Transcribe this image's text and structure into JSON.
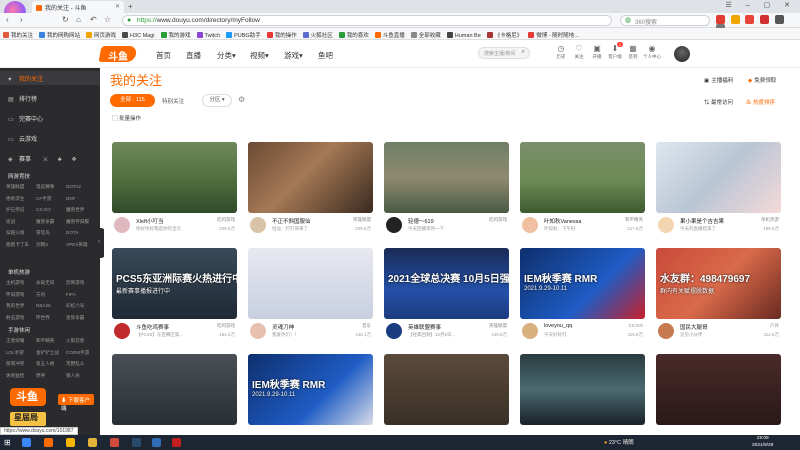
{
  "browser": {
    "tab_title": "我的关注 - 斗鱼",
    "url_protocol": "https://",
    "url_rest": "www.douyu.com/directory/myFollow",
    "search_placeholder": "360搜索",
    "bookmarks": [
      "我的关注",
      "我的网购网站",
      "网页游戏",
      "H3C Magi",
      "我的游戏",
      "Twitch",
      "PUBG助手",
      "我的操作",
      "火狐社区",
      "我的喜欢",
      "斗鱼直播",
      "全部收藏",
      "Human Be",
      "《卡格尼》",
      "微博 - 随时随地..."
    ]
  },
  "site": {
    "logo_text": "斗鱼",
    "nav": [
      "首页",
      "直播",
      "分类",
      "视频",
      "游戏",
      "鱼吧"
    ],
    "search_placeholder": "搜索主播/房间",
    "header_icons": [
      "历史",
      "关注",
      "开播",
      "客户端",
      "签到",
      "个人中心"
    ],
    "badge": "1"
  },
  "sidebar": {
    "items": [
      "我的关注",
      "排行榜",
      "完赛中心",
      "云游戏"
    ],
    "row3": [
      "赛事",
      "",
      "",
      ""
    ],
    "sections": [
      {
        "title": "网游竞技",
        "items": [
          "英雄联盟",
          "电竞赛事",
          "DOTA2",
          "绝地求生",
          "CF手游",
          "DNF",
          "炉石传说",
          "CS:GO",
          "魔兽世界",
          "逆战",
          "魔兽争霸",
          "魔兽怀旧服",
          "穿越火线",
          "冒险岛",
          "DOTA",
          "跑跑卡丁车",
          "剑网3",
          "APEX英雄"
        ]
      },
      {
        "title": "单机热游",
        "items": [
          "主机游戏",
          "永劫无间",
          "恐怖游戏",
          "怀旧游戏",
          "方舟",
          "FIFA",
          "我的世界",
          "NBA2K",
          "彩虹六号",
          "射击游戏",
          "环世界",
          "星际争霸"
        ]
      },
      {
        "title": "手游休闲",
        "items": [
          "王者荣耀",
          "和平精英",
          "火影忍者",
          "LOL手游",
          "金铲铲之战",
          "CODM手游",
          "部落冲突",
          "第五人格",
          "荒野乱斗",
          "休闲益智",
          "原神",
          "狼人杀"
        ]
      }
    ],
    "download_label": "下载客户端",
    "foot_logo": "斗鱼",
    "foot_sub": "星届局"
  },
  "main": {
    "title": "我的关注",
    "top_right": [
      "主播福利",
      "免费领取"
    ],
    "filters": {
      "all": "全部 · 115",
      "special": "特别关注",
      "zone": "分区"
    },
    "batch": "批量操作",
    "sort": [
      "最常访问",
      "热度排序"
    ],
    "cards": [
      {
        "title": "Xleft小叮当",
        "cat": "吃鸡游戏",
        "sub": "你好你好我是你的宝贝",
        "heat": "229.5万"
      },
      {
        "title": "不正不斜国服仙",
        "cat": "英雄联盟",
        "sub": "恒仙：钉钉哥来了",
        "heat": "229.6万"
      },
      {
        "title": "轻德～619",
        "cat": "吃鸡游戏",
        "sub": "今天回播等待一下",
        "heat": ""
      },
      {
        "title": "叶知秋Vanessa",
        "cat": "和平精英",
        "sub": "叶知秋：下午好",
        "heat": "217.8万"
      },
      {
        "title": "果小果是个吉吉果",
        "cat": "单机热游",
        "sub": "今天的直播结束了",
        "heat": "198.6万"
      },
      {
        "title": "斗鱼吃鸡赛事",
        "cat": "吃鸡游戏",
        "sub": "【PCS5】东亚赛区第...",
        "heat": "164.5万",
        "overlay": "PCS5东亚洲际赛火热进行中",
        "overlay2": "最新赛事播报进行中"
      },
      {
        "title": "灵魂刀神",
        "cat": "音乐",
        "sub": "我爱你们！！",
        "heat": "145.1万"
      },
      {
        "title": "英雄联盟赛事",
        "cat": "英雄联盟",
        "sub": "【经典回顾】10月5日...",
        "heat": "140.5万",
        "overlay": "2021全球总决赛 10月5日强势开幕"
      },
      {
        "title": "loveyou_qq",
        "cat": "CS:GO",
        "sub": "今天好好打",
        "heat": "116.8万",
        "overlay": "IEM秋季赛 RMR",
        "overlay2": "2021.9.29-10.11"
      },
      {
        "title": "国民大腿哥",
        "cat": "户外",
        "sub": "见见小伙伴",
        "heat": "112.6万",
        "overlay": "水友群：498479697",
        "overlay2": "群内有关赋摆脱数据"
      },
      {
        "title": "",
        "cat": "",
        "sub": "",
        "heat": ""
      },
      {
        "title": "",
        "cat": "",
        "sub": "",
        "heat": "",
        "overlay": "IEM秋季赛 RMR",
        "overlay2": "2021.9.29-10.11"
      },
      {
        "title": "",
        "cat": "",
        "sub": "",
        "heat": ""
      },
      {
        "title": "",
        "cat": "",
        "sub": "",
        "heat": ""
      },
      {
        "title": "",
        "cat": "",
        "sub": "",
        "heat": ""
      }
    ]
  },
  "status_url": "https://www.douyu.com/101987",
  "taskbar": {
    "weather": "23°C 晴朗",
    "time": "19:09",
    "date": "2021/9/29"
  }
}
